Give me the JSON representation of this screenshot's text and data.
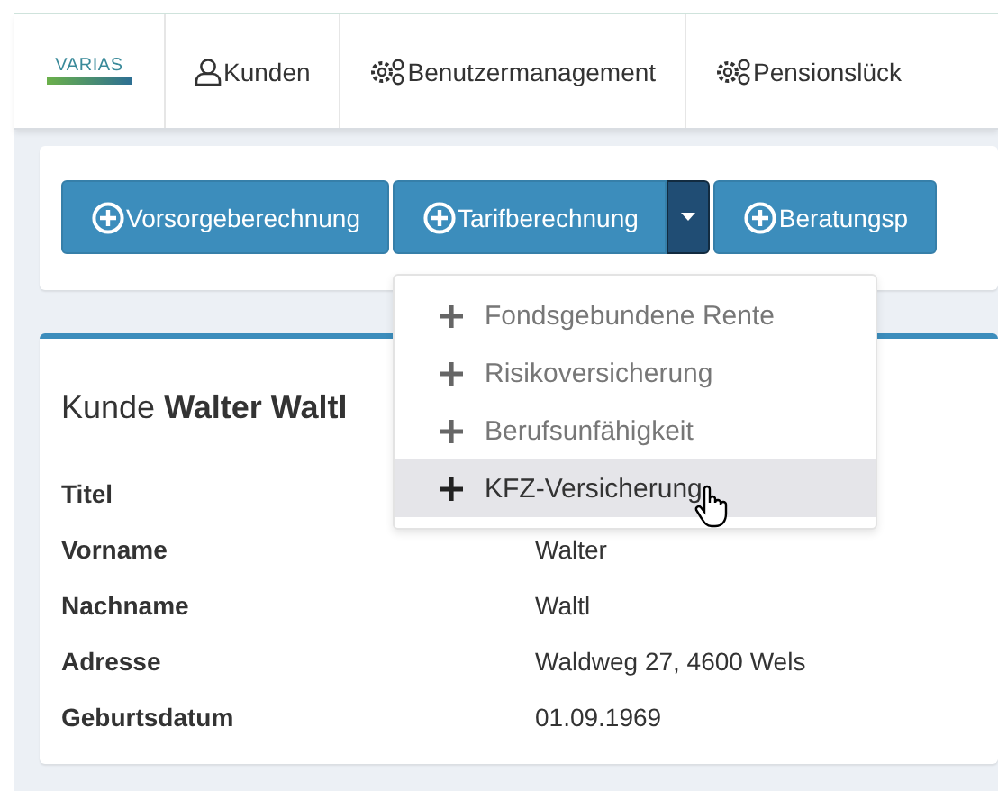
{
  "nav": {
    "logo": "VARIAS",
    "items": [
      {
        "label": "Kunden",
        "kind": "user"
      },
      {
        "label": "Benutzermanagement",
        "kind": "admin"
      },
      {
        "label": "Pensionslück",
        "kind": "admin"
      }
    ]
  },
  "actions": [
    {
      "label": "Vorsorgeberechnung",
      "split": false
    },
    {
      "label": "Tarifberechnung",
      "split": true,
      "expanded": true
    },
    {
      "label": "Beratungsp",
      "split": false
    }
  ],
  "dropdown": [
    {
      "label": "Fondsgebundene Rente",
      "highlighted": false
    },
    {
      "label": "Risikoversicherung",
      "highlighted": false
    },
    {
      "label": "Berufsunfähigkeit",
      "highlighted": false
    },
    {
      "label": "KFZ-Versicherung",
      "highlighted": true
    }
  ],
  "customer": {
    "title": "Kunde **Walter Waltl**",
    "fields": [
      {
        "label": "Titel"
      },
      {
        "label": "Vorname",
        "value": "Walter"
      },
      {
        "label": "Nachname",
        "value": "Waltl"
      },
      {
        "label": "Adresse",
        "value": "Waldweg 27, 4600 Wels"
      },
      {
        "label": "Geburtsdatum",
        "value": "01.09.1969"
      }
    ]
  }
}
